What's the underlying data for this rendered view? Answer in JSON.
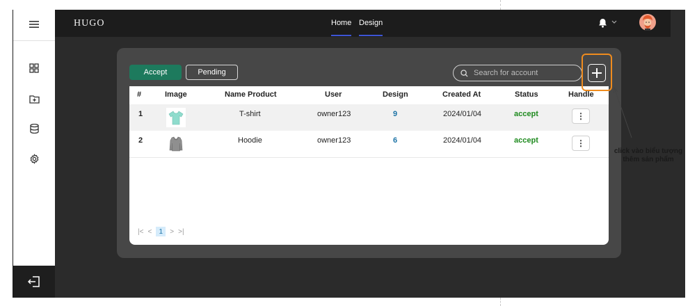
{
  "app": {
    "logo": "HUGO"
  },
  "nav": {
    "home": "Home",
    "design": "Design"
  },
  "tabs": {
    "accept": "Accept",
    "pending": "Pending"
  },
  "search": {
    "placeholder": "Search for account"
  },
  "table": {
    "headers": [
      "#",
      "Image",
      "Name Product",
      "User",
      "Design",
      "Created At",
      "Status",
      "Handle"
    ],
    "rows": [
      {
        "index": "1",
        "image": "tshirt-image",
        "name": "T-shirt",
        "user": "owner123",
        "design": "9",
        "created_at": "2024/01/04",
        "status": "accept",
        "handle": "⋮"
      },
      {
        "index": "2",
        "image": "hoodie-image",
        "name": "Hoodie",
        "user": "owner123",
        "design": "6",
        "created_at": "2024/01/04",
        "status": "accept",
        "handle": "⋮"
      }
    ]
  },
  "pagination": {
    "current": "1"
  },
  "annotation": {
    "line1": "click vào biểu tượng",
    "line2": "thêm sản phẩm"
  },
  "colors": {
    "accent_green": "#1d7a5d",
    "highlight_orange": "#f08c1e",
    "status_green": "#1e8a1e",
    "design_blue": "#1c73a6",
    "nav_underline": "#3d55d6"
  },
  "icons": {
    "sidebar": [
      "menu-icon",
      "dashboard-grid-icon",
      "folder-add-icon",
      "database-icon",
      "settings-gear-icon",
      "logout-icon"
    ],
    "topbar": [
      "bell-icon",
      "chevron-down-icon",
      "user-avatar"
    ],
    "toolbar": [
      "search-icon",
      "add-plus-icon"
    ]
  }
}
